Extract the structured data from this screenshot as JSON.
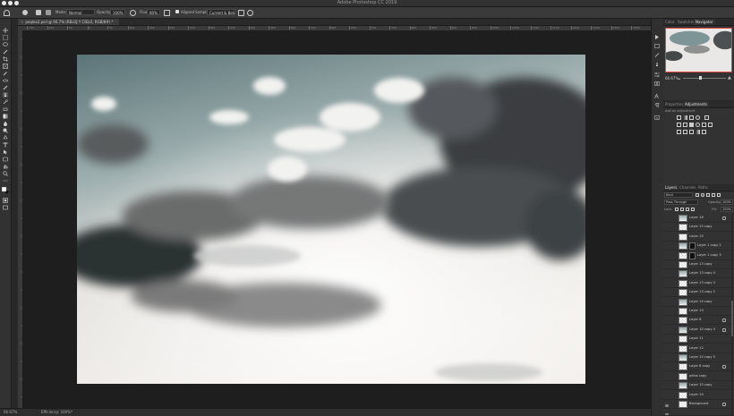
{
  "app": {
    "title": "Adobe Photoshop CC 2019"
  },
  "options": {
    "mode_label": "Mode:",
    "mode_value": "Normal",
    "opacity_label": "Opacity:",
    "opacity_value": "100%",
    "flow_label": "Flow:",
    "flow_value": "80%",
    "aligned_label": "Aligned",
    "sample_label": "Sample:",
    "sample_value": "Current & Below"
  },
  "document": {
    "tab_label": "peqlex2.psd @ 66.7% (RELOJ Y CIELO, RGB/8#) *"
  },
  "ruler": {
    "ticks": [
      "150",
      "100",
      "50",
      "0",
      "50",
      "100",
      "150",
      "200",
      "250",
      "300",
      "350",
      "400",
      "450",
      "500",
      "550",
      "600",
      "650",
      "700",
      "750",
      "800",
      "850",
      "900",
      "950",
      "1000",
      "1050",
      "1100",
      "1150",
      "1200",
      "1250",
      "1300",
      "1350",
      "1400"
    ]
  },
  "status": {
    "zoom": "66.67%",
    "efficiency": "Efficiency: 100%*"
  },
  "navigator": {
    "tabs": [
      "Color",
      "Swatches",
      "Navigator"
    ],
    "active_tab": "Navigator",
    "zoom": "66.67%"
  },
  "adjustments": {
    "tabs": [
      "Properties",
      "Adjustments"
    ],
    "active_tab": "Adjustments",
    "hint": "Add an adjustment"
  },
  "layers_panel": {
    "tabs": [
      "Layers",
      "Channels",
      "Paths"
    ],
    "active_tab": "Layers",
    "kind": "Kind",
    "blend_mode": "Pass Through",
    "opacity_label": "Opacity:",
    "opacity_value": "100%",
    "lock_label": "Lock:",
    "fill_label": "Fill:",
    "fill_value": "100%",
    "layers": [
      {
        "name": "Layer 18",
        "eye": false,
        "badge": true
      },
      {
        "name": "Layer 15 copy",
        "eye": false,
        "badge": false
      },
      {
        "name": "Layer 15",
        "eye": false,
        "badge": false
      },
      {
        "name": "Layer 1 copy 2",
        "eye": false,
        "badge": false,
        "mask": true
      },
      {
        "name": "Layer 1 copy 3",
        "eye": false,
        "badge": false,
        "mask": true
      },
      {
        "name": "Layer 13 copy",
        "eye": false,
        "badge": false
      },
      {
        "name": "Layer 13 copy 4",
        "eye": false,
        "badge": false
      },
      {
        "name": "Layer 13 copy 3",
        "eye": false,
        "badge": false
      },
      {
        "name": "Layer 13 copy 2",
        "eye": false,
        "badge": false
      },
      {
        "name": "Layer 14 copy",
        "eye": false,
        "badge": false
      },
      {
        "name": "Layer 13",
        "eye": false,
        "badge": false
      },
      {
        "name": "Layer 6",
        "eye": false,
        "badge": true
      },
      {
        "name": "Layer 10 copy 4",
        "eye": false,
        "badge": true
      },
      {
        "name": "Layer 11",
        "eye": false,
        "badge": false
      },
      {
        "name": "Layer 12",
        "eye": false,
        "badge": false
      },
      {
        "name": "Layer 10 copy 5",
        "eye": false,
        "badge": false
      },
      {
        "name": "Layer 8 copy",
        "eye": false,
        "badge": true
      },
      {
        "name": "pelos copy",
        "eye": false,
        "badge": false
      },
      {
        "name": "Layer 10 copy",
        "eye": false,
        "badge": false
      },
      {
        "name": "Layer 10",
        "eye": true,
        "badge": false
      },
      {
        "name": "Background",
        "eye": true,
        "badge": true
      }
    ]
  },
  "colors": {
    "accent_red": "#e0463c",
    "panel": "#323232",
    "canvas_bg": "#1e1e1e"
  }
}
